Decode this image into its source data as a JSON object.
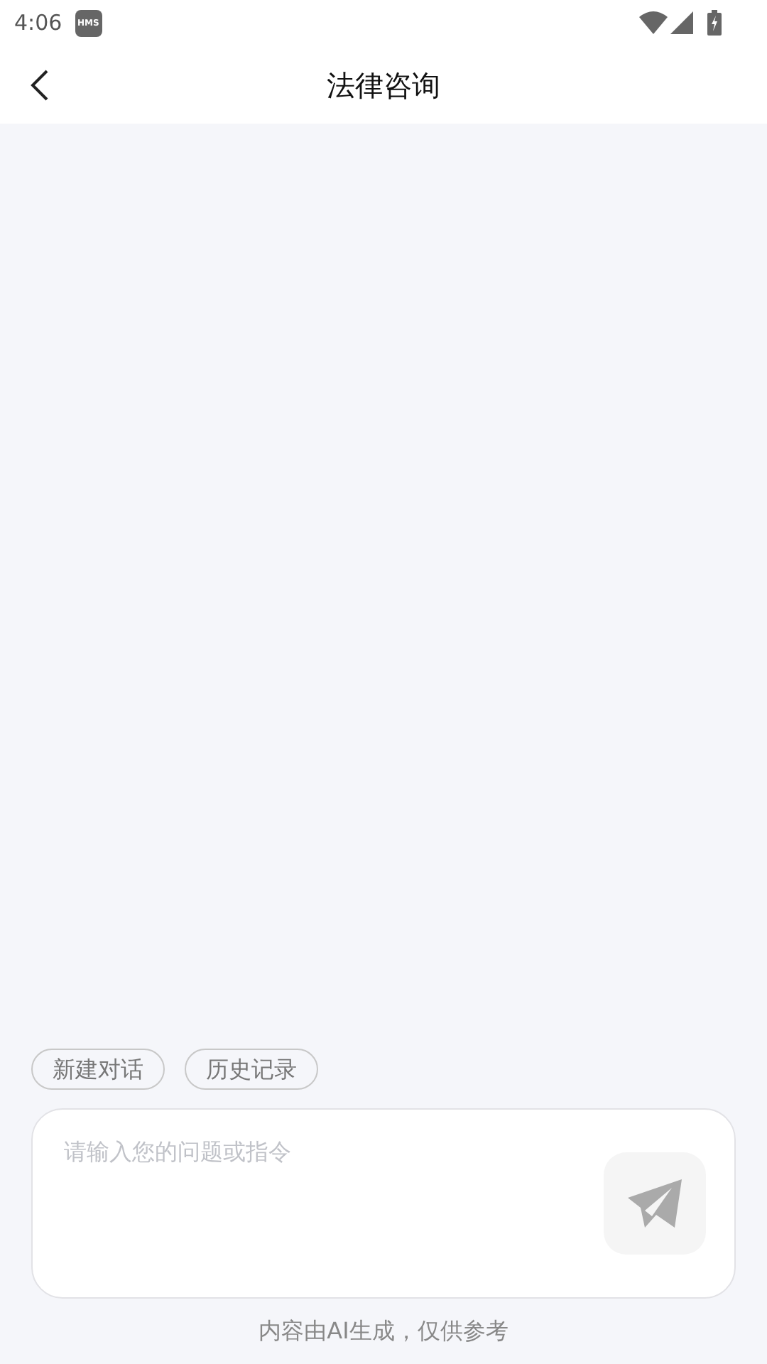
{
  "status_bar": {
    "time": "4:06",
    "badge": "HMS"
  },
  "header": {
    "title": "法律咨询"
  },
  "quick_actions": [
    {
      "label": "新建对话"
    },
    {
      "label": "历史记录"
    }
  ],
  "input": {
    "placeholder": "请输入您的问题或指令"
  },
  "disclaimer": "内容由AI生成，仅供参考"
}
